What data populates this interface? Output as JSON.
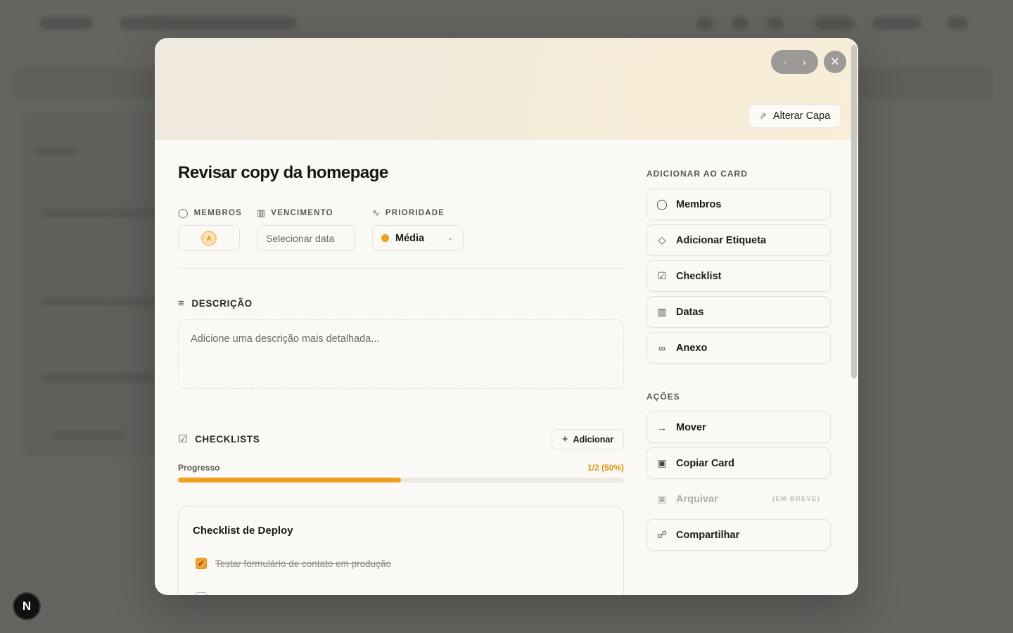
{
  "card": {
    "title": "Revisar copy da homepage",
    "cover_button": "Alterar Capa",
    "nav": {
      "prev_icon": "chevron-left-icon",
      "next_icon": "chevron-right-icon",
      "close_icon": "close-icon"
    }
  },
  "fields": {
    "members_label": "MEMBROS",
    "members_avatar": "A",
    "due_label": "VENCIMENTO",
    "due_placeholder": "Selecionar data",
    "priority_label": "PRIORIDADE",
    "priority_value": "Média",
    "priority_color": "#f29f1b"
  },
  "description": {
    "heading": "DESCRIÇÃO",
    "placeholder": "Adicione uma descrição mais detalhada..."
  },
  "checklists": {
    "heading": "CHECKLISTS",
    "add_label": "Adicionar",
    "progress_label": "Progresso",
    "progress_text": "1/2 (50%)",
    "progress_fraction": 0.5,
    "accent_color": "#f0a11c",
    "lists": [
      {
        "title": "Checklist de Deploy",
        "items": [
          {
            "text": "Testar formulário de contato em produção",
            "done": true
          }
        ]
      }
    ]
  },
  "sidebar": {
    "add_heading": "ADICIONAR AO CARD",
    "add_items": [
      {
        "label": "Membros",
        "icon": "users-icon"
      },
      {
        "label": "Adicionar Etiqueta",
        "icon": "tag-icon"
      },
      {
        "label": "Checklist",
        "icon": "clipboard-check-icon"
      },
      {
        "label": "Datas",
        "icon": "calendar-icon"
      },
      {
        "label": "Anexo",
        "icon": "paperclip-icon"
      }
    ],
    "actions_heading": "AÇÕES",
    "actions": [
      {
        "label": "Mover",
        "icon": "arrow-right-icon"
      },
      {
        "label": "Copiar Card",
        "icon": "archive-icon"
      },
      {
        "label": "Arquivar",
        "icon": "archive-icon",
        "badge": "(EM BREVE)",
        "disabled": true
      },
      {
        "label": "Compartilhar",
        "icon": "share-icon"
      }
    ]
  },
  "dev_badge": "N"
}
